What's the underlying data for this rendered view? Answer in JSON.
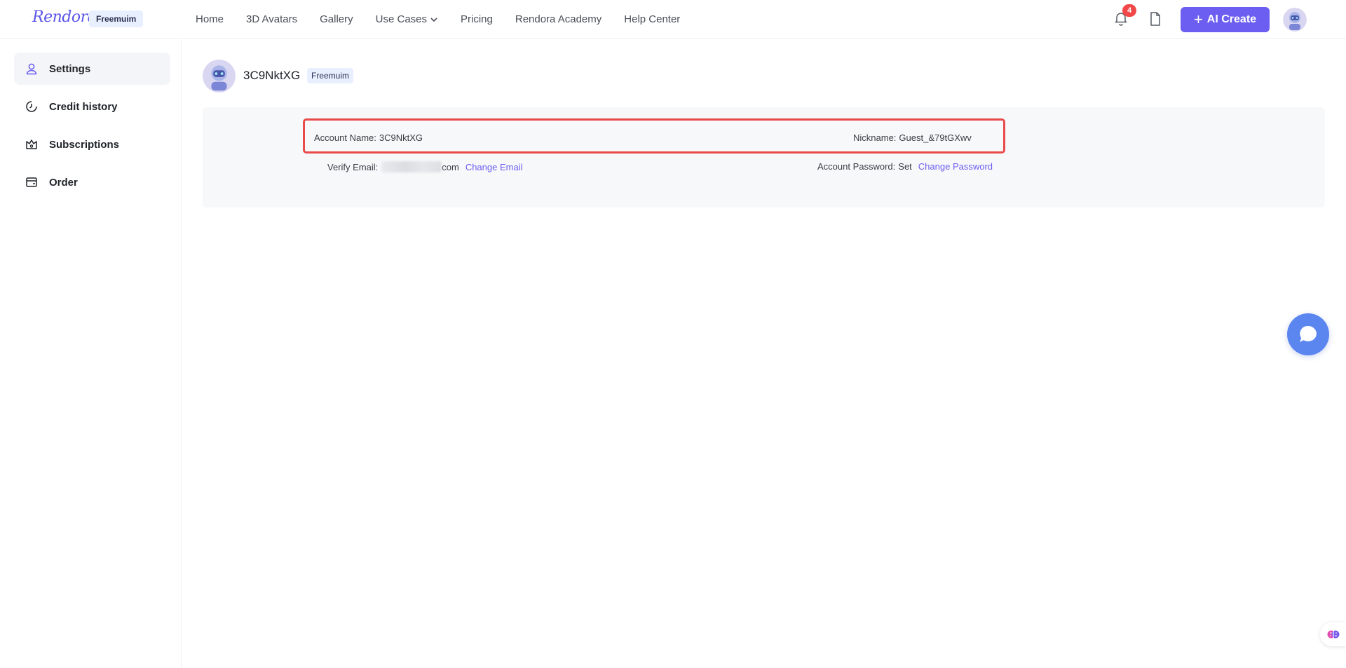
{
  "header": {
    "logo_text": "Rendora",
    "plan_badge": "Freemuim",
    "nav": [
      {
        "label": "Home"
      },
      {
        "label": "3D Avatars"
      },
      {
        "label": "Gallery"
      },
      {
        "label": "Use Cases",
        "has_dropdown": true
      },
      {
        "label": "Pricing"
      },
      {
        "label": "Rendora Academy"
      },
      {
        "label": "Help Center"
      }
    ],
    "notification_count": "4",
    "ai_create_label": "AI Create"
  },
  "sidebar": {
    "items": [
      {
        "label": "Settings",
        "icon": "user-icon",
        "active": true
      },
      {
        "label": "Credit history",
        "icon": "clock-icon"
      },
      {
        "label": "Subscriptions",
        "icon": "crown-icon"
      },
      {
        "label": "Order",
        "icon": "wallet-icon"
      }
    ]
  },
  "profile": {
    "name": "3C9NktXG",
    "badge": "Freemuim"
  },
  "account": {
    "account_name_label": "Account Name:",
    "account_name_value": "3C9NktXG",
    "nickname_label": "Nickname:",
    "nickname_value": "Guest_&79tGXwv",
    "verify_email_label": "Verify Email:",
    "verify_email_suffix": "com",
    "change_email_link": "Change Email",
    "password_label": "Account Password:",
    "password_value": "Set",
    "change_password_link": "Change Password"
  },
  "colors": {
    "accent": "#6c5ef0",
    "highlight_border": "#e94a4a",
    "chat_bubble": "#5b86f0",
    "badge_bg": "#e8efff"
  }
}
